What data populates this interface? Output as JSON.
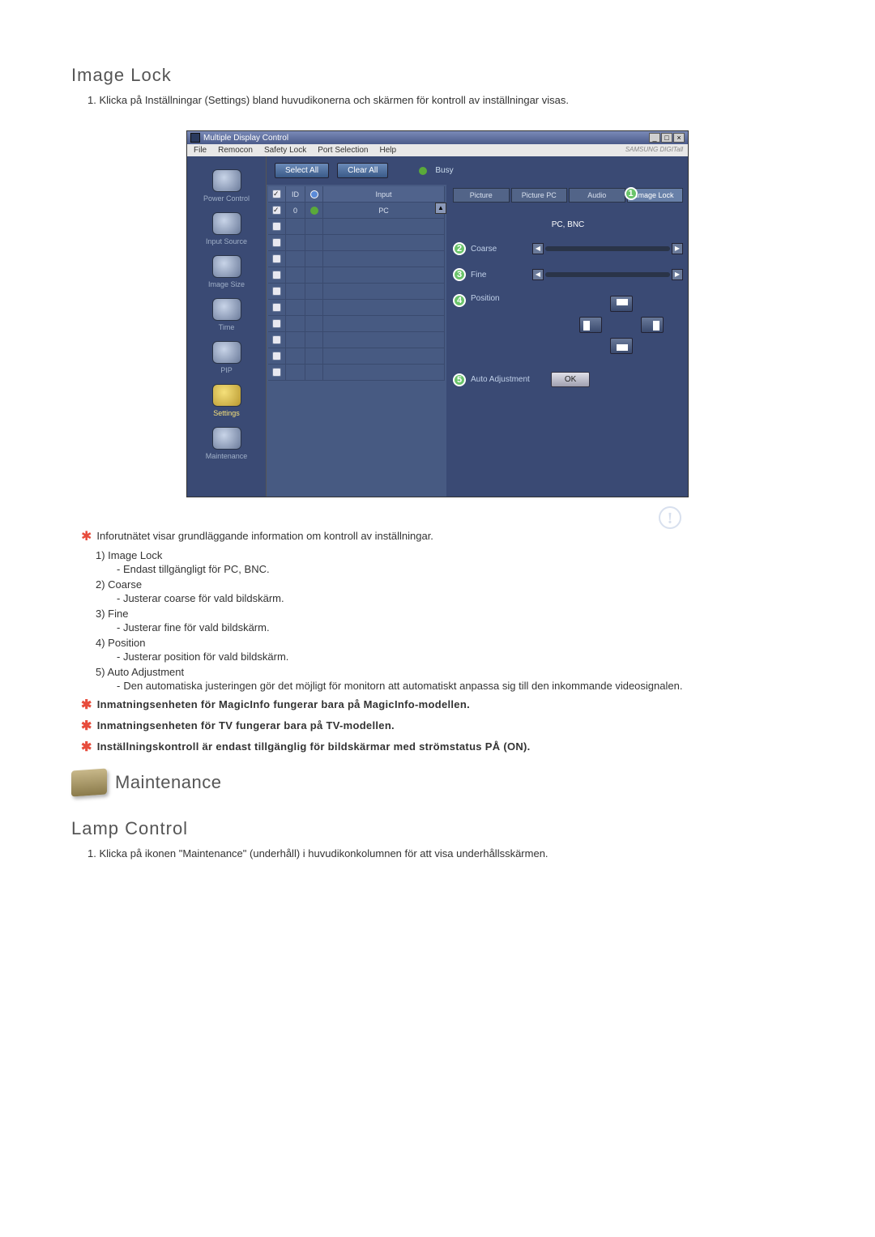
{
  "image_lock": {
    "title": "Image Lock",
    "intro": "1.  Klicka på Inställningar (Settings) bland huvudikonerna och skärmen för kontroll av inställningar visas."
  },
  "app": {
    "window_title": "Multiple Display Control",
    "brand": "SAMSUNG DIGITall",
    "menu": {
      "file": "File",
      "remocon": "Remocon",
      "safety": "Safety Lock",
      "port": "Port Selection",
      "help": "Help"
    },
    "toolbar": {
      "select_all": "Select All",
      "clear_all": "Clear All",
      "busy": "Busy"
    },
    "sidebar": {
      "power": "Power Control",
      "input": "Input Source",
      "image_size": "Image Size",
      "time": "Time",
      "pip": "PIP",
      "settings": "Settings",
      "maintenance": "Maintenance"
    },
    "grid": {
      "h_id": "ID",
      "h_input": "Input",
      "row0": {
        "id": "0",
        "input": "PC"
      }
    },
    "panel": {
      "tabs": {
        "picture": "Picture",
        "picture_pc": "Picture PC",
        "audio": "Audio",
        "image_lock": "Image Lock"
      },
      "sub_heading": "PC, BNC",
      "coarse": "Coarse",
      "fine": "Fine",
      "position": "Position",
      "auto_adj": "Auto Adjustment",
      "ok": "OK"
    }
  },
  "info": {
    "star1": "Inforutnätet visar grundläggande information om kontroll av inställningar.",
    "n1": "1)  Image Lock",
    "n1s": "- Endast tillgängligt för PC, BNC.",
    "n2": "2)  Coarse",
    "n2s": "- Justerar coarse för vald bildskärm.",
    "n3": "3)  Fine",
    "n3s": "- Justerar fine för vald bildskärm.",
    "n4": "4)  Position",
    "n4s": "- Justerar position för vald bildskärm.",
    "n5": "5)  Auto Adjustment",
    "n5s_prefix": "-",
    "n5s": "Den automatiska justeringen gör det möjligt för monitorn att automatiskt anpassa sig till den inkommande videosignalen.",
    "star2": "Inmatningsenheten för MagicInfo fungerar bara på MagicInfo-modellen.",
    "star3": "Inmatningsenheten för TV fungerar bara på TV-modellen.",
    "star4": "Inställningskontroll är endast tillgänglig för bildskärmar med strömstatus PÅ (ON)."
  },
  "maintenance_heading": "Maintenance",
  "lamp": {
    "title": "Lamp Control",
    "intro": "1.  Klicka på ikonen \"Maintenance\" (underhåll) i huvudikonkolumnen för att visa underhållsskärmen."
  }
}
